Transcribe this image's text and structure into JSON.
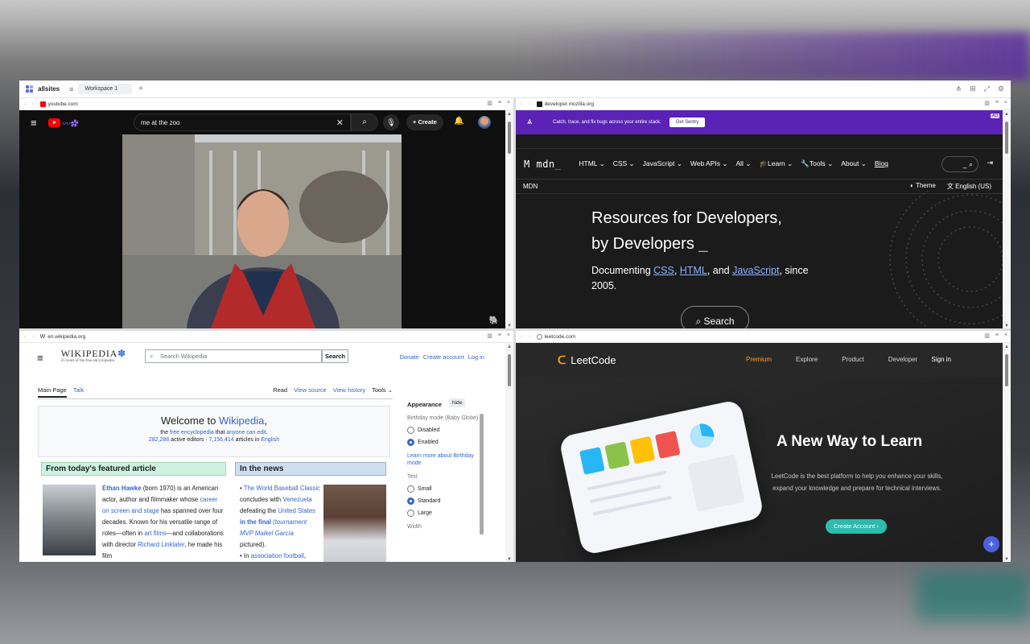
{
  "app": {
    "name": "allsites",
    "workspace_tab": "Workspace 1"
  },
  "panes": {
    "youtube": {
      "url": "youtube.com",
      "search_value": "me at the zoo",
      "create_label": "Create"
    },
    "mdn": {
      "url": "developer.mozilla.org",
      "ad_text": "Catch, trace, and fix bugs across your entire stack.",
      "ad_button": "Get Sentry",
      "ad_tag": "AD",
      "logo": "mdn",
      "logo_cursor": "_",
      "nav": [
        "HTML",
        "CSS",
        "JavaScript",
        "Web APIs",
        "All",
        "Learn",
        "Tools",
        "About"
      ],
      "blog": "Blog",
      "search_cursor": "_",
      "sub_left": "MDN",
      "theme": "Theme",
      "language": "English (US)",
      "hero_line1": "Resources for Developers,",
      "hero_line2": "by Developers",
      "hero_cursor": "_",
      "desc_prefix": "Documenting ",
      "desc_css": "CSS",
      "desc_comma": ", ",
      "desc_html": "HTML",
      "desc_and": ", and ",
      "desc_js": "JavaScript",
      "desc_suffix": ", since 2005.",
      "search_button": "Search"
    },
    "wikipedia": {
      "url": "en.wikipedia.org",
      "logo_title": "WIKIPEDIA",
      "logo_sub": "25 years of the free encyclopedia",
      "search_placeholder": "Search Wikipedia",
      "search_button": "Search",
      "user_links": [
        "Donate",
        "Create account",
        "Log in"
      ],
      "tabs_left": [
        "Main Page",
        "Talk"
      ],
      "tabs_right": [
        "Read",
        "View source",
        "View history",
        "Tools"
      ],
      "welcome_prefix": "Welcome to ",
      "welcome_link": "Wikipedia",
      "welcome_suffix": ",",
      "tagline_the": "the ",
      "tagline_free": "free encyclopedia",
      "tagline_that": " that ",
      "tagline_edit": "anyone can edit",
      "tagline_dot": ".",
      "stats_editors": "282,288",
      "stats_editors_label": " active editors · ",
      "stats_articles": "7,156,414",
      "stats_articles_label": " articles in ",
      "stats_lang": "English",
      "featured_heading": "From today's featured article",
      "featured_name": "Ethan Hawke",
      "featured_text1": " (born 1970) is an American actor, author and filmmaker whose ",
      "featured_link1": "career on screen and stage",
      "featured_text2": " has spanned over four decades. Known for his versatile range of roles—often in ",
      "featured_link2": "art films",
      "featured_text3": "—and collaborations with director ",
      "featured_link3": "Richard Linklater",
      "featured_text4": ", he made his film",
      "news_heading": "In the news",
      "news_link1": "The World Baseball Classic",
      "news_text1": " concludes with ",
      "news_link2": "Venezuela",
      "news_text2": " defeating the ",
      "news_link3": "United States",
      "news_text3": " in the ",
      "news_link4": "final",
      "news_italic": "(tournament MVP Maikel García",
      "news_text4": " pictured).",
      "news_item2_prefix": "In ",
      "news_item2_link": "association football",
      "news_item2_suffix": ",",
      "appearance": {
        "title": "Appearance",
        "hide": "hide",
        "birthday_label": "Birthday mode (Baby Globe)",
        "disabled": "Disabled",
        "enabled": "Enabled",
        "learn_more": "Learn more about Birthday mode",
        "text_label": "Text",
        "small": "Small",
        "standard": "Standard",
        "large": "Large",
        "width_label": "Width"
      }
    },
    "leetcode": {
      "url": "leetcode.com",
      "logo": "LeetCode",
      "nav": [
        "Premium",
        "Explore",
        "Product",
        "Developer"
      ],
      "sign_in": "Sign in",
      "title": "A New Way to Learn",
      "desc": "LeetCode is the best platform to help you enhance your skills, expand your knowledge and prepare for technical interviews.",
      "button": "Create Account ›",
      "fab": "+"
    }
  },
  "colors": {
    "mdn_purple": "#5a22b5",
    "wiki_link": "#3366cc",
    "lc_orange": "#ffa116",
    "lc_teal": "#2cbbad",
    "yt_red": "#ff0000"
  }
}
